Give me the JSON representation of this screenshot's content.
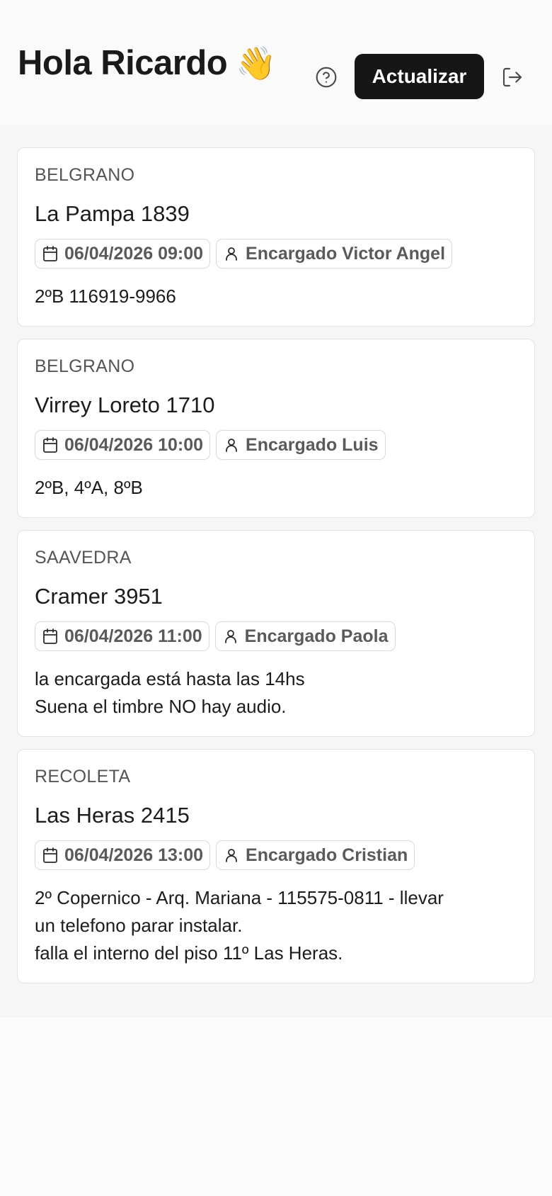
{
  "header": {
    "greeting": "Hola Ricardo",
    "greeting_emoji": "👋",
    "refresh_label": "Actualizar",
    "help_icon": "help-circle-icon",
    "logout_icon": "logout-icon"
  },
  "colors": {
    "primary_button": "#161616",
    "page_background": "#f6f6f6",
    "card_background": "#ffffff",
    "muted_text": "#555555"
  },
  "visits": [
    {
      "neighborhood": "BELGRANO",
      "address": "La Pampa 1839",
      "datetime": "06/04/2026 09:00",
      "contact": "Encargado Victor Angel",
      "notes": "2ºB  116919-9966"
    },
    {
      "neighborhood": "BELGRANO",
      "address": "Virrey Loreto 1710",
      "datetime": "06/04/2026 10:00",
      "contact": "Encargado Luis",
      "notes": "2ºB, 4ºA, 8ºB"
    },
    {
      "neighborhood": "SAAVEDRA",
      "address": "Cramer 3951",
      "datetime": "06/04/2026 11:00",
      "contact": "Encargado Paola",
      "notes": "la encargada está hasta las 14hs\nSuena el timbre NO hay audio."
    },
    {
      "neighborhood": "RECOLETA",
      "address": "Las Heras 2415",
      "datetime": "06/04/2026 13:00",
      "contact": "Encargado Cristian",
      "notes": "2º Copernico - Arq. Mariana - 115575-0811 - llevar\nun telefono parar instalar.\nfalla el interno del piso 11º Las Heras."
    }
  ]
}
